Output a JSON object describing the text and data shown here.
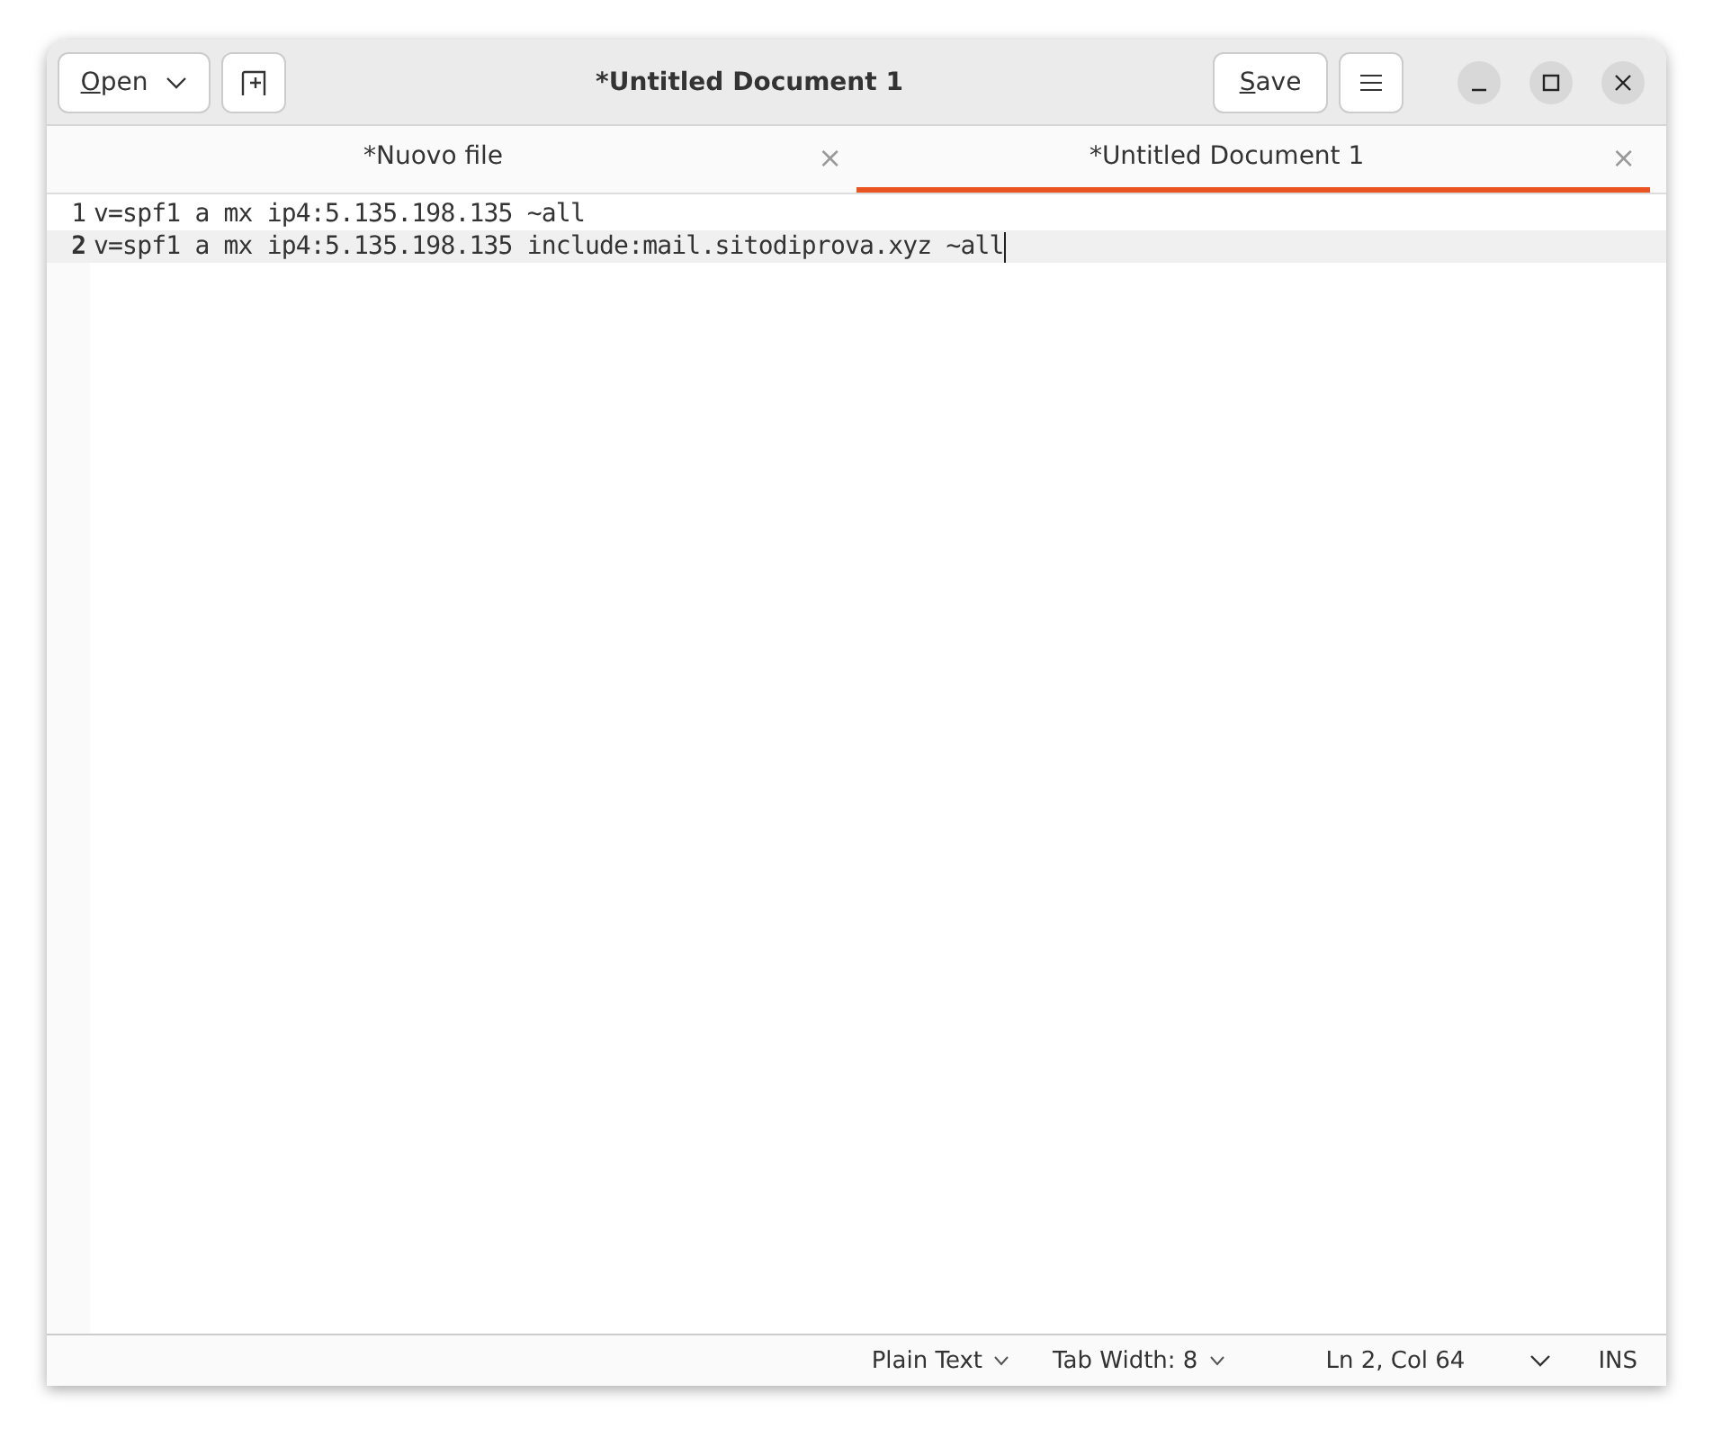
{
  "window": {
    "title": "*Untitled Document 1"
  },
  "header": {
    "open_button": "Open",
    "save_button": "Save"
  },
  "tabs": [
    {
      "label": "*Nuovo file",
      "selected": false,
      "close": "×"
    },
    {
      "label": "*Untitled Document 1",
      "selected": true,
      "close": "×"
    }
  ],
  "editor": {
    "lines": [
      {
        "number": "1",
        "text": "v=spf1 a mx ip4:5.135.198.135 ~all",
        "current": false
      },
      {
        "number": "2",
        "text": "v=spf1 a mx ip4:5.135.198.135 include:mail.sitodiprova.xyz ~all",
        "current": true
      }
    ]
  },
  "status_bar": {
    "language": "Plain Text",
    "tab_width": "Tab Width: 8",
    "position": "Ln 2, Col 64",
    "mode": "INS"
  }
}
